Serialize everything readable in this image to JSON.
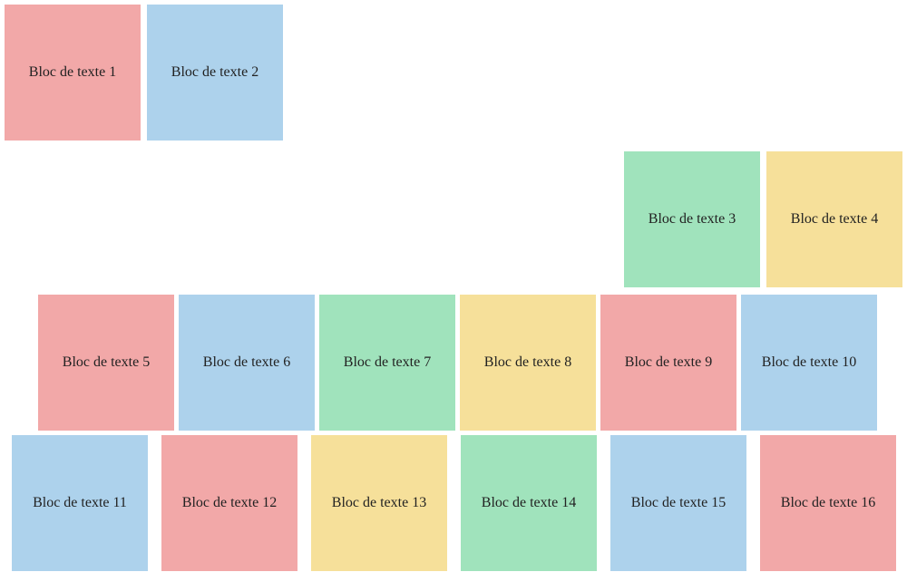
{
  "blocks": {
    "b1": {
      "label": "Bloc de texte 1",
      "color": "red"
    },
    "b2": {
      "label": "Bloc de texte 2",
      "color": "blue"
    },
    "b3": {
      "label": "Bloc de texte 3",
      "color": "green"
    },
    "b4": {
      "label": "Bloc de texte 4",
      "color": "yellow"
    },
    "b5": {
      "label": "Bloc de texte 5",
      "color": "red"
    },
    "b6": {
      "label": "Bloc de texte 6",
      "color": "blue"
    },
    "b7": {
      "label": "Bloc de texte 7",
      "color": "green"
    },
    "b8": {
      "label": "Bloc de texte 8",
      "color": "yellow"
    },
    "b9": {
      "label": "Bloc de texte 9",
      "color": "red"
    },
    "b10": {
      "label": "Bloc de texte 10",
      "color": "blue"
    },
    "b11": {
      "label": "Bloc de texte 11",
      "color": "blue"
    },
    "b12": {
      "label": "Bloc de texte 12",
      "color": "red"
    },
    "b13": {
      "label": "Bloc de texte 13",
      "color": "yellow"
    },
    "b14": {
      "label": "Bloc de texte 14",
      "color": "green"
    },
    "b15": {
      "label": "Bloc de texte 15",
      "color": "blue"
    },
    "b16": {
      "label": "Bloc de texte 16",
      "color": "red"
    }
  },
  "palette": {
    "red": "#f2a8a8",
    "blue": "#add2ec",
    "green": "#a0e3bc",
    "yellow": "#f6e09a"
  }
}
